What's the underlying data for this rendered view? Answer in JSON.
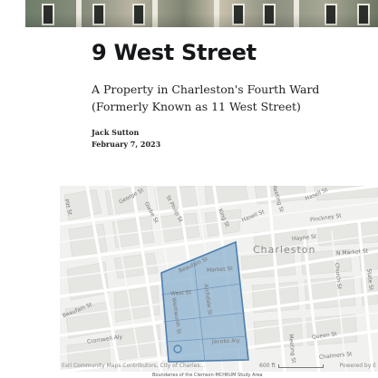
{
  "article": {
    "title": "9 West Street",
    "subtitle": "A Property in Charleston's Fourth Ward (Formerly Known as 11 West Street)",
    "author": "Jack Sutton",
    "date": "February 7, 2023"
  },
  "map": {
    "city_label": "Charleston",
    "streets": {
      "george": "George St",
      "glebe": "Glebe St",
      "st_philip": "St Philip St",
      "pitt": "Pitt St",
      "king": "King St",
      "hasell": "Hasell St",
      "meeting": "Meeting St",
      "hasell_2": "Hasell St",
      "pinckney": "Pinckney St",
      "hayne": "Hayne St",
      "n_market": "N Market St",
      "beaufain": "Beaufain St",
      "market": "Market St",
      "west": "West St",
      "archdale": "Archdale St",
      "church": "Church St",
      "state": "State St",
      "cromwell": "Cromwell Aly",
      "jacobs": "Jacobs Aly",
      "queen": "Queen St",
      "chalmers": "Chalmers St",
      "wentworth": "Wentworth St",
      "meeting_2": "Meeting St"
    },
    "attribution": "Esri Community Maps Contributors, City of Charles...",
    "scale_label": "600 ft",
    "powered_by": "Powered by E",
    "caption": "Boundaries of the Clemson-MCHRUM Study Area",
    "colors": {
      "area_fill": "#8fb3d0",
      "area_stroke": "#4c7fae",
      "background": "#f1f1ef",
      "roads": "#ffffff",
      "blocks": "#e4e4e1"
    }
  },
  "banner": {
    "icon": "street-photo-banner"
  }
}
